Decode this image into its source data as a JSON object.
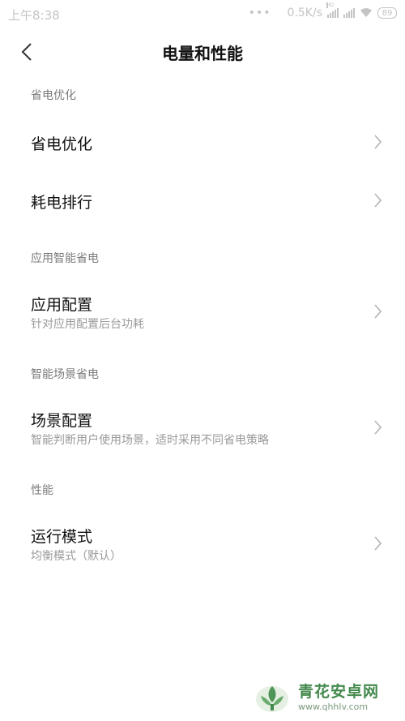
{
  "status_bar": {
    "time": "上午8:38",
    "dots": "•••",
    "network_speed": "0.5K/s",
    "hd_label": "HD",
    "battery_level": "89"
  },
  "header": {
    "title": "电量和性能"
  },
  "sections": [
    {
      "label": "省电优化",
      "items": [
        {
          "title": "省电优化",
          "subtitle": ""
        },
        {
          "title": "耗电排行",
          "subtitle": ""
        }
      ]
    },
    {
      "label": "应用智能省电",
      "items": [
        {
          "title": "应用配置",
          "subtitle": "针对应用配置后台功耗"
        }
      ]
    },
    {
      "label": "智能场景省电",
      "items": [
        {
          "title": "场景配置",
          "subtitle": "智能判断用户使用场景，适时采用不同省电策略"
        }
      ]
    },
    {
      "label": "性能",
      "items": [
        {
          "title": "运行模式",
          "subtitle": "均衡模式（默认）"
        }
      ]
    }
  ],
  "watermark": {
    "name": "青花安卓网",
    "url": "www.qhhlv.com"
  },
  "colors": {
    "title_text": "#111111",
    "section_label": "#7a7a7a",
    "subtitle_text": "#9a9a9a",
    "chevron": "#b3b3b3",
    "status_text": "#c4c4c4",
    "watermark_green": "#2f7d3a"
  }
}
